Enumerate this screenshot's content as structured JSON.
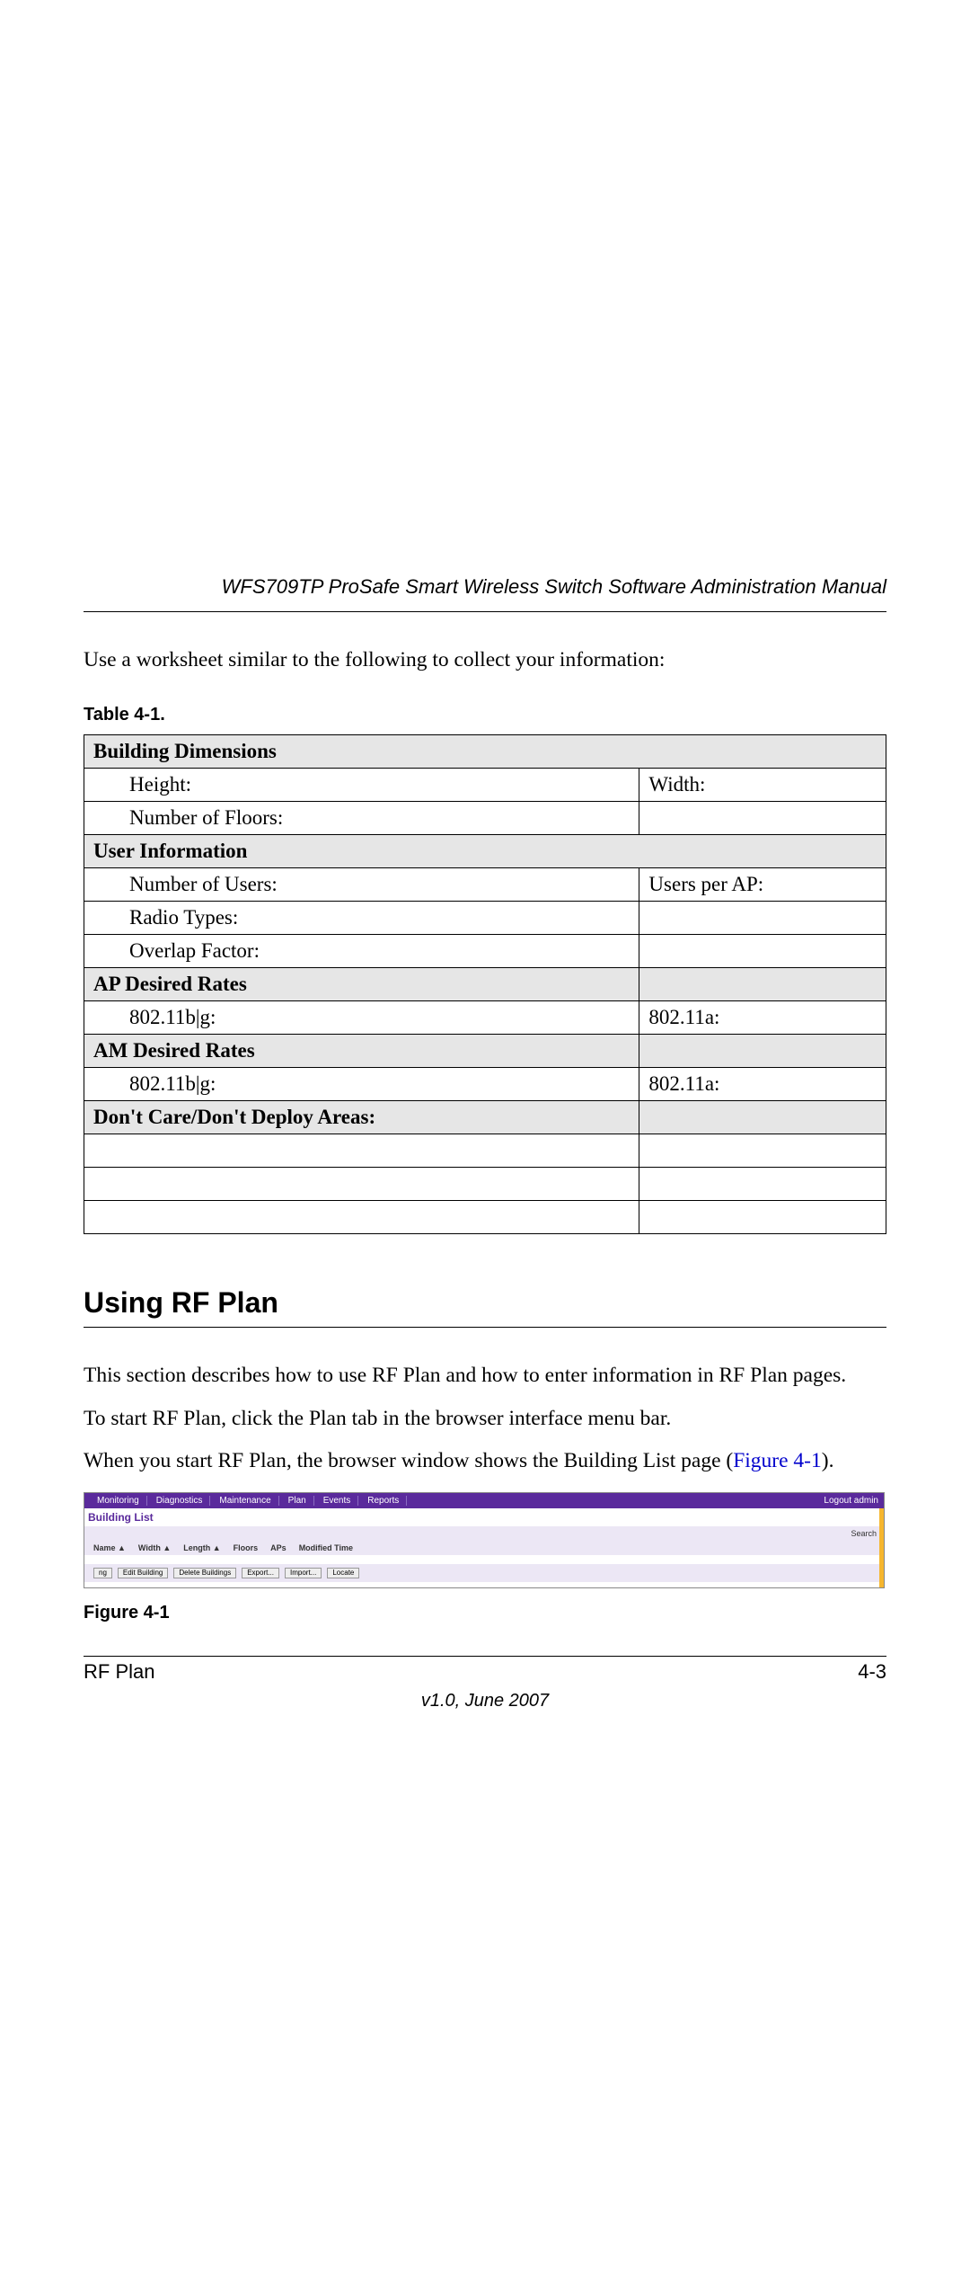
{
  "header": "WFS709TP ProSafe Smart Wireless Switch Software Administration Manual",
  "intro": "Use a worksheet similar to the following to collect your information:",
  "tableLabel": "Table 4-1.",
  "table": {
    "r1": "Building Dimensions",
    "r2a": "Height:",
    "r2b": "Width:",
    "r3": "Number of Floors:",
    "r4": "User Information",
    "r5a": "Number of Users:",
    "r5b": "Users per AP:",
    "r6": "Radio Types:",
    "r7": "Overlap Factor:",
    "r8": "AP Desired Rates",
    "r9a": "802.11b|g:",
    "r9b": "802.11a:",
    "r10": "AM Desired Rates",
    "r11a": "802.11b|g:",
    "r11b": "802.11a:",
    "r12": "Don't Care/Don't Deploy Areas:"
  },
  "sectionHeading": "Using RF Plan",
  "p1": "This section describes how to use RF Plan and how to enter information in RF Plan pages.",
  "p2": "To start RF Plan, click the Plan tab in the browser interface menu bar.",
  "p3a": "When you start RF Plan, the browser window shows the Building List page (",
  "p3link": "Figure 4-1",
  "p3b": ").",
  "screenshot": {
    "tabs": [
      "Monitoring",
      "Diagnostics",
      "Maintenance",
      "Plan",
      "Events",
      "Reports"
    ],
    "logout": "Logout admin",
    "title": "Building List",
    "search": "Search",
    "cols": [
      "",
      "Name ▲",
      "Width ▲",
      "Length ▲",
      "Floors",
      "APs",
      "Modified Time"
    ],
    "btns": [
      "ng",
      "Edit Building",
      "Delete Buildings",
      "Export...",
      "Import...",
      "Locate"
    ]
  },
  "figureLabel": "Figure 4-1",
  "footerLeft": "RF Plan",
  "footerRight": "4-3",
  "version": "v1.0, June 2007"
}
